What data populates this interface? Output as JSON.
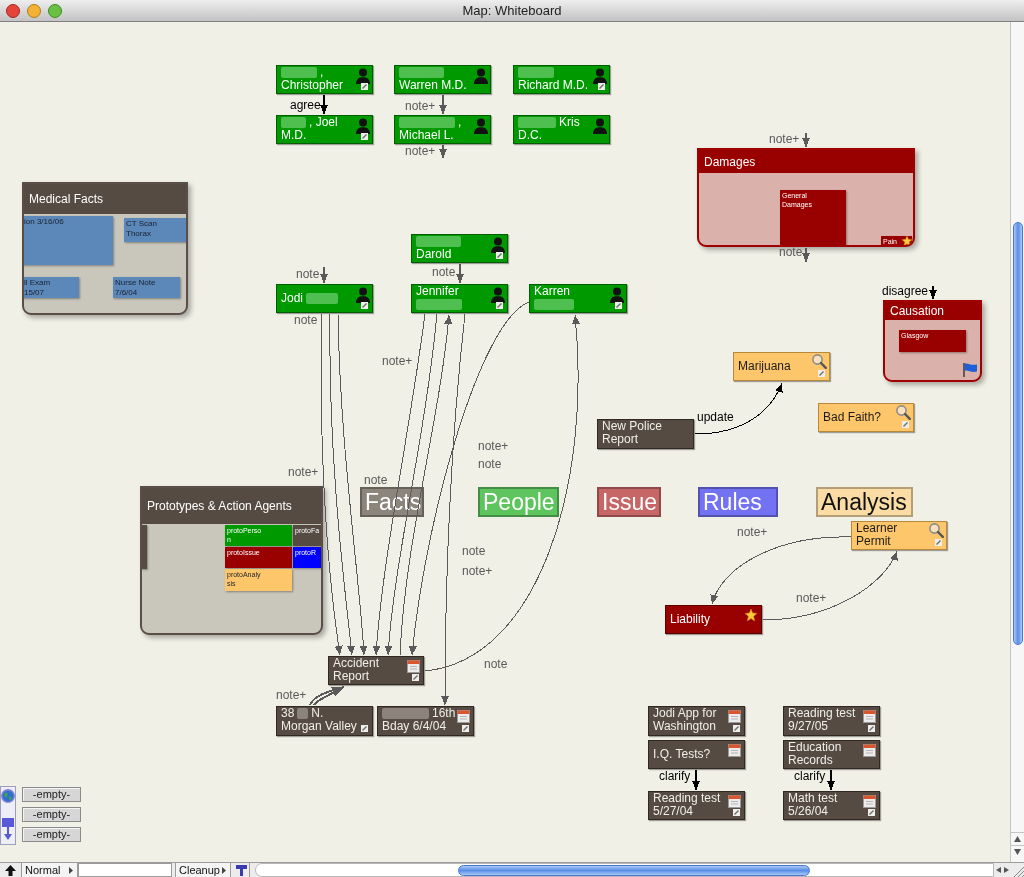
{
  "window": {
    "title": "Map: Whiteboard"
  },
  "containers": [
    {
      "title": "Damages",
      "kind": "issue",
      "flagged": false,
      "children": [
        {
          "lines": [
            "General",
            "Damages"
          ],
          "color": "#990000",
          "starred": false
        },
        {
          "lines": [
            "Pain"
          ],
          "color": "#990000",
          "starred": true
        }
      ]
    },
    {
      "title": "Medical Facts",
      "kind": "fact",
      "flagged": false,
      "children": [
        {
          "lines": [
            "ion 3/16/06"
          ],
          "color": "#5b87b9",
          "starred": false
        },
        {
          "lines": [
            "CT Scan",
            "Thorax"
          ],
          "color": "#5b87b9",
          "starred": false
        },
        {
          "lines": [
            "ll Exam",
            "15/07"
          ],
          "color": "#5b87b9",
          "starred": false
        },
        {
          "lines": [
            "Nurse Note",
            "7/6/04"
          ],
          "color": "#5b87b9",
          "starred": false
        }
      ]
    },
    {
      "title": "Causation",
      "kind": "issue",
      "flagged": true,
      "children": [
        {
          "lines": [
            "Glasgow"
          ],
          "color": "#990000",
          "starred": false
        }
      ]
    },
    {
      "title": "Prototypes & Action Agents",
      "kind": "fact",
      "flagged": false,
      "children": [
        {
          "color": "#564b43",
          "starred": false
        },
        {
          "lines": [
            "protoPerso",
            "n"
          ],
          "color": "#009900",
          "starred": false
        },
        {
          "lines": [
            "protoFa"
          ],
          "color": "#564b43",
          "starred": false
        },
        {
          "lines": [
            "protoIssue"
          ],
          "color": "#990000",
          "starred": false
        },
        {
          "lines": [
            "protoR"
          ],
          "color": "#0000ff",
          "starred": false
        },
        {
          "lines": [
            "protoAnaly",
            "sis"
          ],
          "color": "#fec66a",
          "starred": false
        }
      ]
    }
  ],
  "nodes": [
    {
      "kind": "person",
      "lines": [
        [
          {
            "kind": "blur"
          },
          ","
        ],
        [
          "Christopher"
        ]
      ],
      "linked": true,
      "dated": false,
      "starred": false
    },
    {
      "kind": "person",
      "lines": [
        [
          {
            "kind": "blur"
          }
        ],
        [
          "Warren M.D."
        ]
      ],
      "linked": false,
      "dated": false,
      "starred": false
    },
    {
      "kind": "person",
      "lines": [
        [
          {
            "kind": "blur"
          }
        ],
        [
          "Richard M.D."
        ]
      ],
      "linked": true,
      "dated": false,
      "starred": false
    },
    {
      "kind": "person",
      "lines": [
        [
          {
            "kind": "blur"
          },
          ", Joel"
        ],
        [
          "M.D."
        ]
      ],
      "linked": true,
      "dated": false,
      "starred": false
    },
    {
      "kind": "person",
      "lines": [
        [
          {
            "kind": "blur"
          },
          ","
        ],
        [
          "Michael L."
        ]
      ],
      "linked": false,
      "dated": false,
      "starred": false
    },
    {
      "kind": "person",
      "lines": [
        [
          {
            "kind": "blur"
          },
          "Kris"
        ],
        [
          "D.C."
        ]
      ],
      "linked": false,
      "dated": false,
      "starred": false
    },
    {
      "kind": "person",
      "lines": [
        [
          {
            "kind": "blur"
          }
        ],
        [
          "Darold"
        ]
      ],
      "linked": true,
      "dated": false,
      "starred": false
    },
    {
      "kind": "person",
      "lines": [
        [
          "Jodi",
          {
            "kind": "blur"
          }
        ]
      ],
      "linked": true,
      "dated": false,
      "starred": false
    },
    {
      "kind": "person",
      "lines": [
        [
          "Jennifer"
        ],
        [
          {
            "kind": "blur"
          }
        ]
      ],
      "linked": true,
      "dated": false,
      "starred": false
    },
    {
      "kind": "person",
      "lines": [
        [
          "Karren"
        ],
        [
          {
            "kind": "blur"
          }
        ]
      ],
      "linked": true,
      "dated": false,
      "starred": false
    },
    {
      "kind": "analysis",
      "lines": [
        [
          "Marijuana"
        ]
      ],
      "linked": true,
      "dated": false,
      "starred": false
    },
    {
      "kind": "analysis",
      "lines": [
        [
          "Bad Faith?"
        ]
      ],
      "linked": true,
      "dated": false,
      "starred": false
    },
    {
      "kind": "fact",
      "lines": [
        [
          "New Police"
        ],
        [
          "Report"
        ]
      ],
      "linked": false,
      "dated": false,
      "starred": false
    },
    {
      "kind": "analysis",
      "lines": [
        [
          "Learner"
        ],
        [
          "Permit"
        ]
      ],
      "linked": true,
      "dated": false,
      "starred": false
    },
    {
      "kind": "issue",
      "lines": [
        [
          "Liability"
        ]
      ],
      "linked": false,
      "dated": false,
      "starred": true
    },
    {
      "kind": "fact",
      "lines": [
        [
          "Accident"
        ],
        [
          "Report"
        ]
      ],
      "linked": true,
      "dated": true,
      "starred": false
    },
    {
      "kind": "fact",
      "lines": [
        [
          "38",
          {
            "kind": "blur"
          },
          "N."
        ],
        [
          "Morgan Valley"
        ]
      ],
      "linked": true,
      "dated": false,
      "starred": false
    },
    {
      "kind": "fact",
      "lines": [
        [
          {
            "kind": "blur"
          },
          "16th"
        ],
        [
          "Bday 6/4/04"
        ]
      ],
      "linked": true,
      "dated": true,
      "starred": false
    },
    {
      "kind": "fact",
      "lines": [
        [
          "Jodi App for"
        ],
        [
          "Washington"
        ]
      ],
      "linked": true,
      "dated": true,
      "starred": false
    },
    {
      "kind": "fact",
      "lines": [
        [
          "Reading test"
        ],
        [
          "9/27/05"
        ]
      ],
      "linked": true,
      "dated": true,
      "starred": false
    },
    {
      "kind": "fact",
      "lines": [
        [
          "I.Q. Tests?"
        ]
      ],
      "linked": false,
      "dated": true,
      "starred": false
    },
    {
      "kind": "fact",
      "lines": [
        [
          "Education"
        ],
        [
          "Records"
        ]
      ],
      "linked": false,
      "dated": true,
      "starred": false
    },
    {
      "kind": "fact",
      "lines": [
        [
          "Reading test"
        ],
        [
          "5/27/04"
        ]
      ],
      "linked": true,
      "dated": true,
      "starred": false
    },
    {
      "kind": "fact",
      "lines": [
        [
          "Math test"
        ],
        [
          "5/26/04"
        ]
      ],
      "linked": true,
      "dated": true,
      "starred": false
    }
  ],
  "categories": [
    {
      "label": "Facts",
      "color": "#8c857c"
    },
    {
      "label": "People",
      "color": "#5ec45e"
    },
    {
      "label": "Issue",
      "color": "#c66666"
    },
    {
      "label": "Rules",
      "color": "#7272f2"
    },
    {
      "label": "Analysis",
      "color": "#fadca4"
    }
  ],
  "edges": [
    {
      "label": "agree",
      "color": "#000000"
    },
    {
      "label": "note+",
      "color": "#5a5a5a"
    },
    {
      "label": "note+",
      "color": "#5a5a5a"
    },
    {
      "label": "note+",
      "color": "#5a5a5a"
    },
    {
      "label": "note",
      "color": "#5a5a5a"
    },
    {
      "label": "note",
      "color": "#5a5a5a"
    },
    {
      "label": "note",
      "color": "#5a5a5a"
    },
    {
      "label": "disagree",
      "color": "#000000"
    },
    {
      "label": "note",
      "color": "#5a5a5a"
    },
    {
      "label": "note+",
      "color": "#5a5a5a"
    },
    {
      "label": "update",
      "color": "#000000"
    },
    {
      "label": "note+",
      "color": "#5a5a5a"
    },
    {
      "label": "note+",
      "color": "#5a5a5a"
    },
    {
      "label": "note",
      "color": "#5a5a5a"
    },
    {
      "label": "note",
      "color": "#5a5a5a"
    },
    {
      "label": "note",
      "color": "#5a5a5a"
    },
    {
      "label": "note+",
      "color": "#5a5a5a"
    },
    {
      "label": "note+",
      "color": "#5a5a5a"
    },
    {
      "label": "note+",
      "color": "#5a5a5a"
    },
    {
      "label": "note",
      "color": "#5a5a5a"
    },
    {
      "label": "note+",
      "color": "#5a5a5a"
    },
    {
      "label": "clarify",
      "color": "#000000"
    },
    {
      "label": "clarify",
      "color": "#000000"
    }
  ],
  "palette": {
    "slots": [
      "-empty-",
      "-empty-",
      "-empty-"
    ]
  },
  "status_bar": {
    "mode": "Normal",
    "command": "Cleanup"
  }
}
